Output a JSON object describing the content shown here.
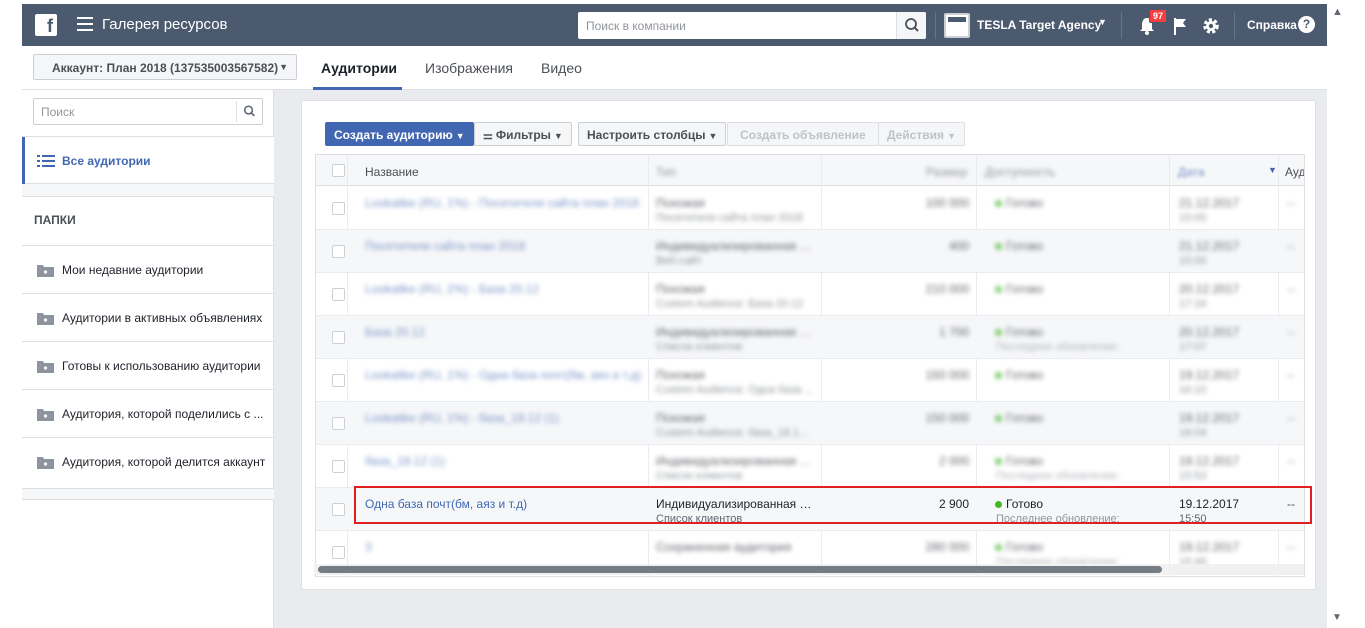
{
  "topbar": {
    "app_title": "Галерея ресурсов",
    "search_placeholder": "Поиск в компании",
    "agency": "TESLA Target Agency",
    "notifications_count": "97",
    "help": "Справка"
  },
  "subbar": {
    "account": "Аккаунт: План 2018 (137535003567582)",
    "tabs": [
      "Аудитории",
      "Изображения",
      "Видео"
    ],
    "active_tab": "Аудитории"
  },
  "sidebar": {
    "search_placeholder": "Поиск",
    "all_audiences": "Все аудитории",
    "folders_heading": "ПАПКИ",
    "folders": [
      "Мои недавние аудитории",
      "Аудитории в активных объявлениях",
      "Готовы к использованию аудитории",
      "Аудитория, которой поделились с ...",
      "Аудитория, которой делится аккаунт"
    ]
  },
  "toolbar": {
    "create_audience": "Создать аудиторию",
    "filters": "Фильтры",
    "columns": "Настроить столбцы",
    "create_ad": "Создать объявление",
    "actions": "Действия"
  },
  "table": {
    "headers": {
      "name": "Название",
      "type": "Тип",
      "size": "Размер",
      "availability": "Доступность",
      "date": "Дата",
      "audience": "Ауд"
    },
    "rows": [
      {
        "name": "Lookalike (RU, 1%) - Посетители сайта план 2018",
        "type": "Похожая",
        "sub": "Посетители сайта план 2018",
        "size": "100 000",
        "avail": "Готово",
        "avail_sub": "",
        "date": "21.12.2017",
        "time": "15:00",
        "dash": "--",
        "blur": true
      },
      {
        "name": "Посетители сайта план 2018",
        "type": "Индивидуализированная а...",
        "sub": "Веб-сайт",
        "size": "400",
        "avail": "Готово",
        "avail_sub": "",
        "date": "21.12.2017",
        "time": "15:00",
        "dash": "--",
        "blur": true
      },
      {
        "name": "Lookalike (RU, 2%) - База 20.12",
        "type": "Похожая",
        "sub": "Custom Audience: База 20.12",
        "size": "210 000",
        "avail": "Готово",
        "avail_sub": "",
        "date": "20.12.2017",
        "time": "17:16",
        "dash": "--",
        "blur": true
      },
      {
        "name": "База 20.12",
        "type": "Индивидуализированная а...",
        "sub": "Список клиентов",
        "size": "1 700",
        "avail": "Готово",
        "avail_sub": "Последнее обновление:",
        "date": "20.12.2017",
        "time": "17:07",
        "dash": "--",
        "blur": true
      },
      {
        "name": "Lookalike (RU, 1%) - Одна база почт(бм, аяз и т.д)",
        "type": "Похожая",
        "sub": "Custom Audience: Одна база ...",
        "size": "150 000",
        "avail": "Готово",
        "avail_sub": "",
        "date": "19.12.2017",
        "time": "16:10",
        "dash": "--",
        "blur": true
      },
      {
        "name": "Lookalike (RU, 1%) - база_18.12 (1)",
        "type": "Похожая",
        "sub": "Custom Audience: база_18.12 ...",
        "size": "150 000",
        "avail": "Готово",
        "avail_sub": "",
        "date": "19.12.2017",
        "time": "16:04",
        "dash": "--",
        "blur": true
      },
      {
        "name": "база_18.12 (1)",
        "type": "Индивидуализированная а...",
        "sub": "Список клиентов",
        "size": "2 000",
        "avail": "Готово",
        "avail_sub": "Последнее обновление:",
        "date": "19.12.2017",
        "time": "15:53",
        "dash": "--",
        "blur": true
      },
      {
        "name": "Одна база почт(бм, аяз и т.д)",
        "type": "Индивидуализированная а...",
        "sub": "Список клиентов",
        "size": "2 900",
        "avail": "Готово",
        "avail_sub": "Последнее обновление:",
        "date": "19.12.2017",
        "time": "15:50",
        "dash": "--",
        "blur": false
      },
      {
        "name": "3",
        "type": "Сохраненная аудитория",
        "sub": "",
        "size": "280 000",
        "avail": "Готово",
        "avail_sub": "Последнее обновление:",
        "date": "19.12.2017",
        "time": "15:46",
        "dash": "--",
        "blur": true
      }
    ]
  }
}
